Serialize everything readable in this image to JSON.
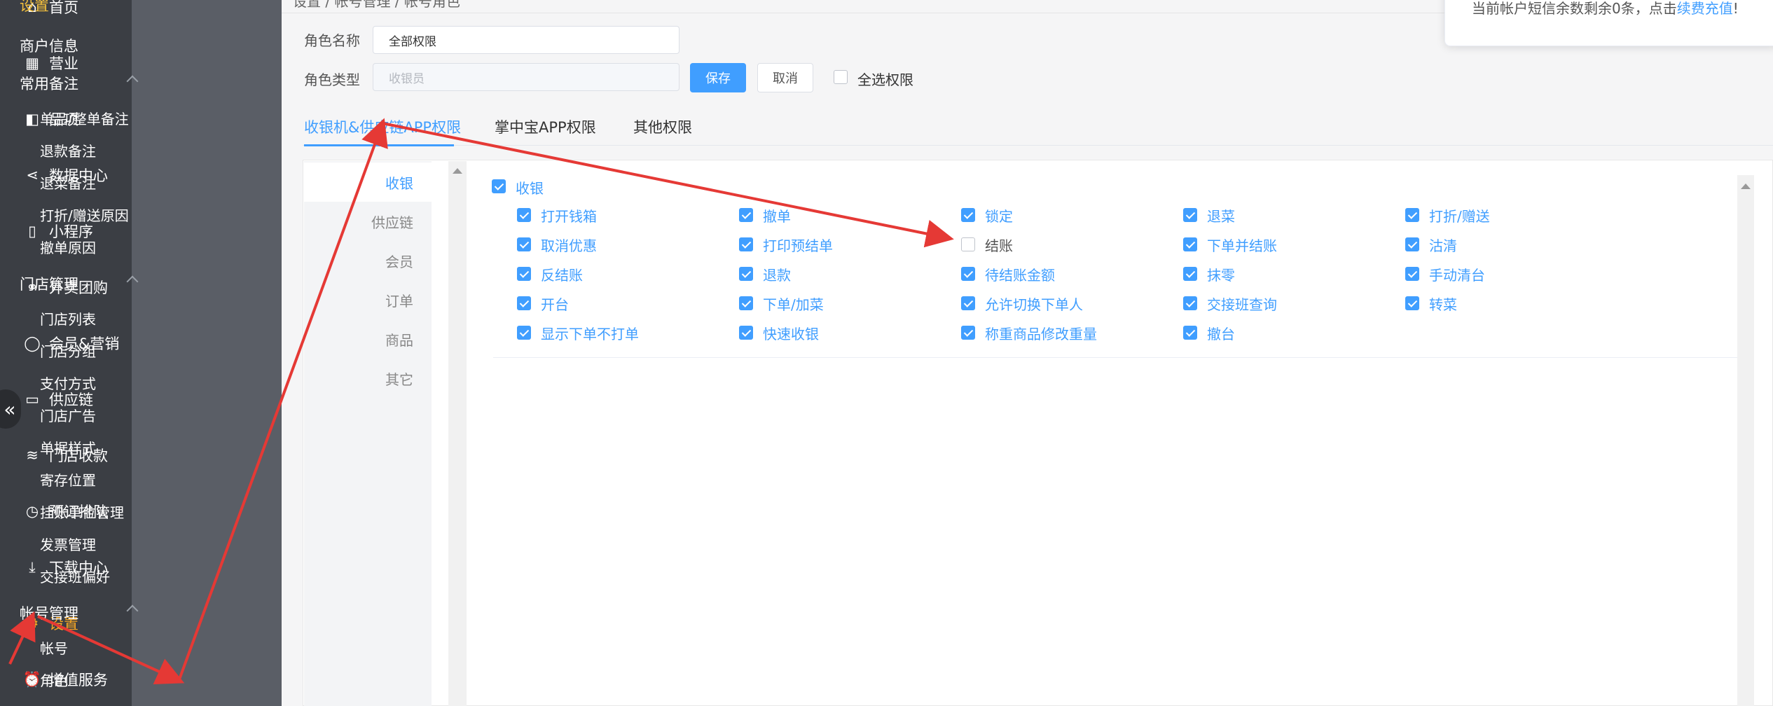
{
  "colors": {
    "accent": "#409eff",
    "nav_bg": "#3b3e44",
    "submenu_bg": "#5a5e66",
    "active_nav": "#f5a623",
    "annotation": "#e53935"
  },
  "breadcrumb": "设置 / 帐号管理 / 帐号角色",
  "nav": {
    "items": [
      {
        "label": "首页",
        "icon": "home-icon"
      },
      {
        "label": "营业",
        "icon": "calendar-icon"
      },
      {
        "label": "品项",
        "icon": "bag-icon"
      },
      {
        "label": "数据中心",
        "icon": "share-icon"
      },
      {
        "label": "小程序",
        "icon": "tablet-icon"
      },
      {
        "label": "外卖团购",
        "icon": "bike-icon"
      },
      {
        "label": "会员&营销",
        "icon": "user-icon"
      },
      {
        "label": "供应链",
        "icon": "truck-icon"
      },
      {
        "label": "门店收款",
        "icon": "database-icon"
      },
      {
        "label": "预订排队",
        "icon": "clock-icon"
      },
      {
        "label": "下载中心",
        "icon": "download-icon"
      },
      {
        "label": "设置",
        "icon": "gear-icon"
      },
      {
        "label": "增值服务",
        "icon": "alarm-icon"
      }
    ],
    "collapse_icon": "«"
  },
  "submenu": {
    "title": "设置",
    "merchant": "商户信息",
    "groups": [
      {
        "label": "常用备注",
        "items": [
          "单品/整单备注",
          "退款备注",
          "退菜备注",
          "打折/赠送原因",
          "撤单原因"
        ]
      },
      {
        "label": "门店管理",
        "items": [
          "门店列表",
          "门店分组",
          "支付方式",
          "门店广告",
          "单据样式",
          "寄存位置",
          "挂账单位管理",
          "发票管理",
          "交接班偏好"
        ]
      },
      {
        "label": "帐号管理",
        "items": [
          "帐号",
          "角色"
        ]
      }
    ]
  },
  "form": {
    "role_name_label": "角色名称",
    "role_name_value": "全部权限",
    "role_type_label": "角色类型",
    "role_type_placeholder": "收银员",
    "save_label": "保存",
    "cancel_label": "取消",
    "select_all_label": "全选权限"
  },
  "tabs": [
    "收银机&供应链APP权限",
    "掌中宝APP权限",
    "其他权限"
  ],
  "side_tabs": [
    "收银",
    "供应链",
    "会员",
    "订单",
    "商品",
    "其它"
  ],
  "perm_group": {
    "label": "收银",
    "checked": true
  },
  "permissions": [
    [
      {
        "label": "打开钱箱",
        "checked": true
      },
      {
        "label": "撤单",
        "checked": true
      },
      {
        "label": "锁定",
        "checked": true
      },
      {
        "label": "退菜",
        "checked": true
      },
      {
        "label": "打折/赠送",
        "checked": true
      }
    ],
    [
      {
        "label": "取消优惠",
        "checked": true
      },
      {
        "label": "打印预结单",
        "checked": true
      },
      {
        "label": "结账",
        "checked": false
      },
      {
        "label": "下单并结账",
        "checked": true
      },
      {
        "label": "沽清",
        "checked": true
      }
    ],
    [
      {
        "label": "反结账",
        "checked": true
      },
      {
        "label": "退款",
        "checked": true
      },
      {
        "label": "待结账金额",
        "checked": true
      },
      {
        "label": "抹零",
        "checked": true
      },
      {
        "label": "手动清台",
        "checked": true
      }
    ],
    [
      {
        "label": "开台",
        "checked": true
      },
      {
        "label": "下单/加菜",
        "checked": true
      },
      {
        "label": "允许切换下单人",
        "checked": true
      },
      {
        "label": "交接班查询",
        "checked": true
      },
      {
        "label": "转菜",
        "checked": true
      }
    ],
    [
      {
        "label": "显示下单不打单",
        "checked": true
      },
      {
        "label": "快速收银",
        "checked": true
      },
      {
        "label": "称重商品修改重量",
        "checked": true
      },
      {
        "label": "撤台",
        "checked": true
      }
    ]
  ],
  "toast": {
    "text": "当前帐户短信余数剩余0条，点击",
    "link": "续费充值",
    "suffix": "!"
  }
}
